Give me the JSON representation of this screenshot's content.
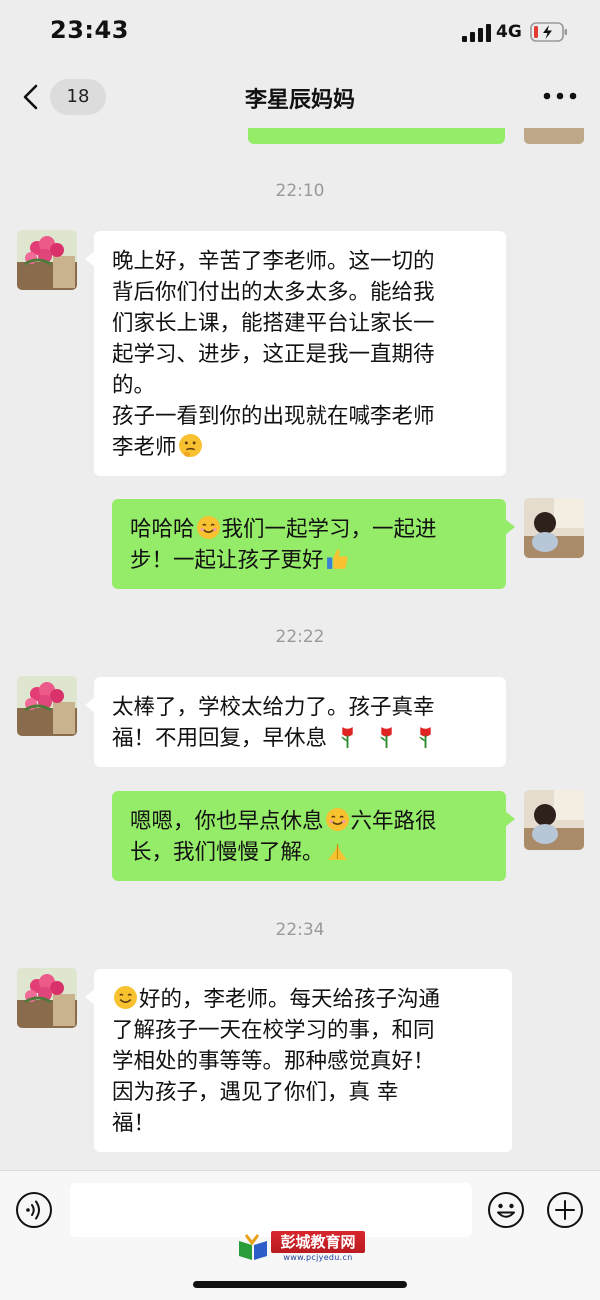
{
  "status": {
    "time": "23:43",
    "network": "4G"
  },
  "nav": {
    "back_count": "18",
    "title": "李星辰妈妈"
  },
  "messages": [
    {
      "type": "time",
      "text": "22:10"
    },
    {
      "type": "in",
      "lines": [
        "晚上好，辛苦了李老师。这一切的",
        "背后你们付出的太多太多。能给我",
        "们家长上课，能搭建平台让家长一",
        "起学习、进步，这正是我一直期待",
        "的。",
        "孩子一看到你的出现就在喊李老师",
        "李老师"
      ],
      "emoji": [
        "thinking-emoji"
      ]
    },
    {
      "type": "out",
      "parts": [
        "哈哈哈",
        "我们一起学习，一起进",
        "步！一起让孩子更好"
      ],
      "emoji": [
        "smile-emoji",
        "thumbs-up-emoji"
      ]
    },
    {
      "type": "time",
      "text": "22:22"
    },
    {
      "type": "in",
      "lines": [
        "太棒了，学校太给力了。孩子真幸",
        "福！不用回复，早休息"
      ],
      "emoji": [
        "rose-emoji",
        "rose-emoji",
        "rose-emoji"
      ]
    },
    {
      "type": "out",
      "parts": [
        "嗯嗯，你也早点休息",
        "六年路很",
        "长，我们慢慢了解。"
      ],
      "emoji": [
        "smile-emoji",
        "folded-hands-emoji"
      ]
    },
    {
      "type": "time",
      "text": "22:34"
    },
    {
      "type": "in",
      "lines": [
        "好的，李老师。每天给孩子沟通",
        "了解孩子一天在校学习的事，和同",
        "学相处的事等等。那种感觉真好！",
        "因为孩子，遇见了你们，真 幸",
        "福！"
      ],
      "emoji": [
        "smile-emoji"
      ]
    }
  ],
  "input": {
    "value": "",
    "placeholder": ""
  },
  "watermark": {
    "title": "彭城教育网",
    "url": "www.pcjyedu.cn"
  },
  "colors": {
    "background": "#ededed",
    "incoming_bubble": "#ffffff",
    "outgoing_bubble": "#95ec69"
  }
}
